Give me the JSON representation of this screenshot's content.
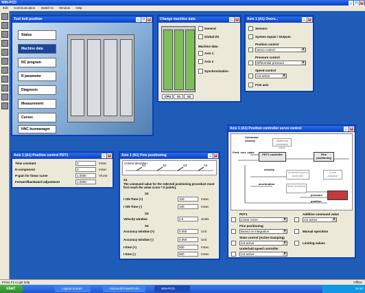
{
  "app": {
    "title": "WIN-PCD",
    "menu": [
      "Edit",
      "Communication",
      "Switch to",
      "Window",
      "Help"
    ]
  },
  "tool_tree": {
    "title": "Tool bolt position",
    "items": [
      "Status",
      "Machine data",
      "NC program",
      "R parameter",
      "Diagnosis",
      "Measurement",
      "Curves",
      "HNC busmanager"
    ],
    "selected": "Machine data"
  },
  "change_machine": {
    "title": "Change machine data",
    "general": "General",
    "global_io": "Global I/O",
    "machine_data_label": "Machine data",
    "axis1": "Axis 1",
    "axis2": "Axis 2",
    "synchronization": "Synchronization",
    "tabs": [
      "CPU",
      "S1",
      "S2"
    ]
  },
  "axis_overview": {
    "title": "Axis 1 (A1) Overv...",
    "sensors": "Sensors",
    "system_io": "System Inputs / Outputs",
    "position_control_label": "Position control",
    "position_control_value": "Servo control",
    "pressure_control_label": "Pressure control",
    "pressure_control_value": "Differential pressure",
    "speed_control_label": "Speed control",
    "speed_control_value": "not active",
    "free_axis": "Free axis"
  },
  "pdt1": {
    "title": "Axis 1 (A1) Position control PDT1",
    "rows": [
      {
        "label": "Time constant",
        "value": "0",
        "unit": "mSec"
      },
      {
        "label": "D-component",
        "value": "0",
        "unit": "mSec"
      },
      {
        "label": "P-gain for linear curve",
        "value": "1.0000",
        "unit": "V/Unit"
      },
      {
        "label": "Forward/backward adjustment",
        "value": "1.0000",
        "unit": ""
      }
    ]
  },
  "fine_positioning": {
    "title": "Axis 1 (A1) Fine positioning",
    "diagram_caption": "Control deviation",
    "switch_labels": [
      "S1",
      "S2",
      "S3",
      "S4"
    ],
    "s1_heading": "S1",
    "s1_text": "The command value for the selected positioning procedure must first reach the value xcom = 0 [unit/s].",
    "s2_heading": "S2",
    "on_time_plus": {
      "label": "I ON-Time (+)",
      "value": "100",
      "unit": "mSec"
    },
    "on_time_minus": {
      "label": "I ON-Time (-)",
      "value": "100",
      "unit": "mSec"
    },
    "s3_heading": "S3",
    "velocity_window": {
      "label": "Velocity window",
      "value": "0.0",
      "unit": "Unit/s"
    },
    "s4_heading": "S4",
    "accuracy_plus": {
      "label": "Accuracy window (+)",
      "value": "0.050",
      "unit": "Unit"
    },
    "accuracy_minus": {
      "label": "Accuracy window (-)",
      "value": "0.050",
      "unit": "Unit"
    },
    "time_plus": {
      "label": "I-time (+)",
      "value": "500",
      "unit": "mSec"
    },
    "time_minus": {
      "label": "I-time (-)",
      "value": "500",
      "unit": "mSec"
    }
  },
  "servo_control": {
    "title": "Axis 1 (A1) Position controller servo control",
    "diagram": {
      "command_velocity": "Command velocity",
      "feed_corr_value": "Feed. corr. value",
      "additional_cmd": "Additional command value",
      "pdt1_controller": "PDT1 controller",
      "fine_positioning": "Fine positioning",
      "velocity": "velocity",
      "underlaid_speed": "Underlaid speed controller",
      "curve_adaption": "Curve adaption",
      "acceleration": "acceleration",
      "state_feedback": "State feedback",
      "pressure": "pressure",
      "position": "position"
    },
    "pdt1_label": "PDT1",
    "pdt1_value": "Linear curve",
    "additive_label": "Additive command value",
    "additive_value": "not active",
    "fine_pos_label": "Fine positioning",
    "fine_pos_value": "Based on integration",
    "manual_operation": "Manual operation",
    "state_control_label": "State control (Active Damping)",
    "state_control_value": "not active",
    "limiting_values": "Limiting values",
    "underlaid_label": "Underlaid speed controller",
    "underlaid_value": "not active"
  },
  "statusbar": {
    "left": "Press F1 to get help.",
    "right": "Offline"
  },
  "taskbar": {
    "start": "start",
    "buttons": [
      "Logical Screen",
      "Microsoft PowerPoint...",
      "WIN-PCD"
    ],
    "clock": "10:40"
  }
}
